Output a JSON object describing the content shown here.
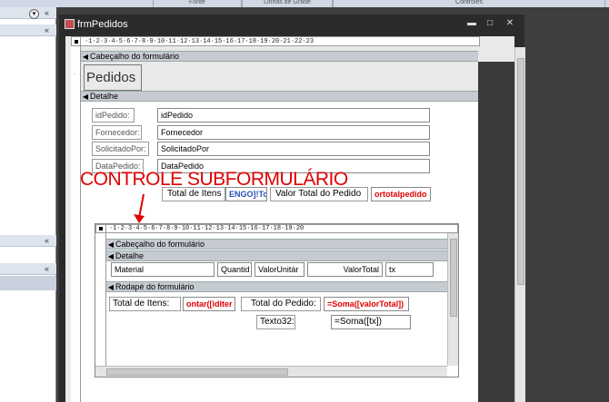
{
  "ribbon": {
    "groups": [
      "Fonte",
      "Linhas de Grade",
      "Controles"
    ]
  },
  "nav": {
    "chevrons": [
      "«",
      "«",
      "«"
    ]
  },
  "window": {
    "title": "frmPedidos",
    "btn_min": "▬",
    "btn_max": "□",
    "btn_close": "✕"
  },
  "ruler_text": "·1·2·3·4·5·6·7·8·9·10·11·12·13·14·15·16·17·18·19·20·21·22·23",
  "sections": {
    "header": "Cabeçalho do formulário",
    "detail": "Detalhe",
    "header_title": "Pedidos"
  },
  "fields": [
    {
      "label": "idPedido:",
      "value": "idPedido"
    },
    {
      "label": "Fornecedor:",
      "value": "Fornecedor"
    },
    {
      "label": "SolicitadoPor:",
      "value": "SolicitadoPor"
    },
    {
      "label": "DataPedido:",
      "value": "DataPedido"
    }
  ],
  "totals": {
    "total_itens_label": "Total de Itens",
    "total_itens_value": "ENGO]!Tc",
    "valor_total_label": "Valor Total do Pedido",
    "valor_total_value": "ortotalpedido"
  },
  "annotation": "CONTROLE SUBFORMULÁRIO",
  "subform": {
    "ruler_text": "·1·2·3·4·5·6·7·8·9·10·11·12·13·14·15·16·17·18·19·20",
    "header": "Cabeçalho do formulário",
    "detail": "Detalhe",
    "footer": "Rodapé do formulário",
    "detail_fields": [
      "Material",
      "Quantid",
      "ValorUnitár",
      "ValorTotal",
      "tx"
    ],
    "footer_total_itens_label": "Total de Itens:",
    "footer_total_itens_value": "ontar([idIter",
    "footer_total_pedido_label": "Total do Pedido:",
    "footer_total_pedido_value": "=Soma([valorTotal])",
    "footer_texto32_label": "Texto32:",
    "footer_texto32_value": "=Soma([tx])"
  }
}
